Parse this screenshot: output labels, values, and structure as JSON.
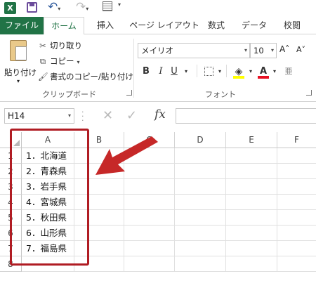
{
  "qat": {
    "logo": "X",
    "icons": [
      "excel-logo-icon",
      "save-icon",
      "undo-icon",
      "redo-icon",
      "customize-qat-icon"
    ],
    "undo": "↶",
    "redo": "↷",
    "dd": "▾"
  },
  "tabs": [
    {
      "label": "ファイル"
    },
    {
      "label": "ホーム"
    },
    {
      "label": "挿入"
    },
    {
      "label": "ページ レイアウト"
    },
    {
      "label": "数式"
    },
    {
      "label": "データ"
    },
    {
      "label": "校閲"
    }
  ],
  "clipboard": {
    "paste_label": "貼り付け",
    "cut_label": "切り取り",
    "copy_label": "コピー",
    "format_painter_label": "書式のコピー/貼り付け",
    "group_label": "クリップボード",
    "dd": "▾"
  },
  "font": {
    "font_name": "メイリオ",
    "font_size": "10",
    "grow": "A˄",
    "shrink": "A˅",
    "bold": "B",
    "italic": "I",
    "underline": "U",
    "font_color_glyph": "A",
    "dd": "▾",
    "group_label": "フォント",
    "fill_color": "#ffff00",
    "font_color": "#e81123"
  },
  "formula_bar": {
    "name_box": "H14",
    "cancel": "✕",
    "enter": "✓",
    "fx": "fx",
    "formula": ""
  },
  "sheet": {
    "columns": [
      "A",
      "B",
      "C",
      "D",
      "E",
      "F"
    ],
    "rows": [
      "1",
      "2",
      "3",
      "4",
      "5",
      "6",
      "7",
      "8"
    ],
    "cells_A": [
      "1．北海道",
      "2．青森県",
      "3．岩手県",
      "4．宮城県",
      "5．秋田県",
      "6．山形県",
      "7．福島県",
      ""
    ]
  },
  "annotation": {
    "box_color": "#b01c23",
    "arrow_color": "#c62828"
  },
  "theme": {
    "accent": "#217346"
  }
}
